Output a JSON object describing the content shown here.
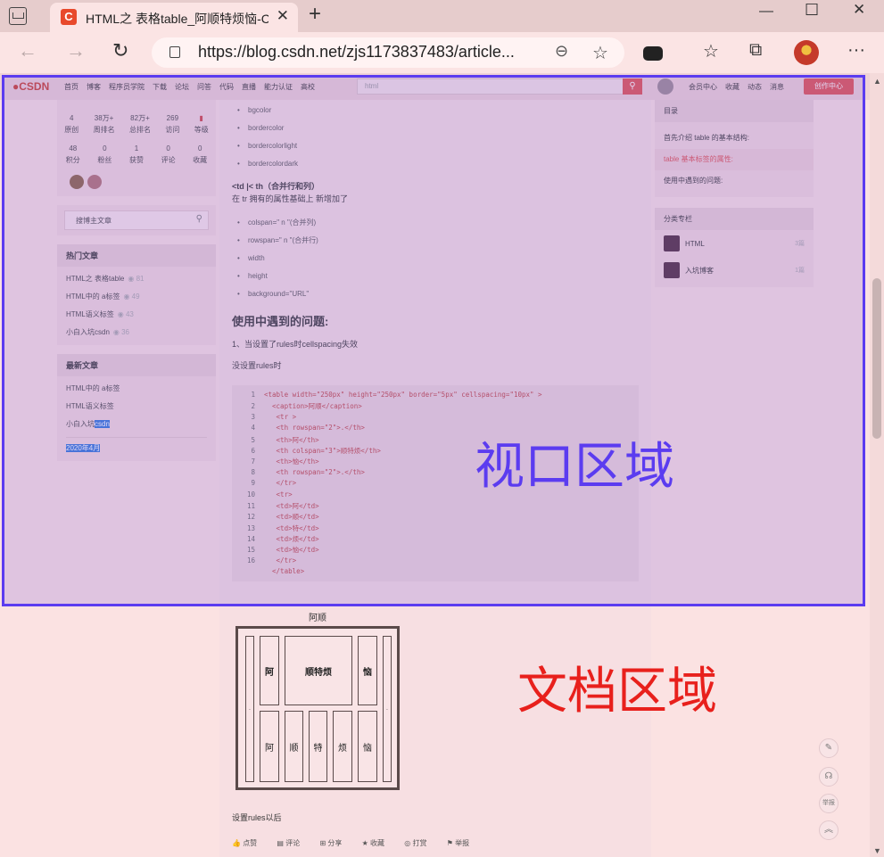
{
  "browser": {
    "tab_title": "HTML之 表格table_阿顺特烦恼-C",
    "tab_favicon": "C",
    "url": "https://blog.csdn.net/zjs1173837483/article...",
    "win_min": "—",
    "win_max": "☐",
    "win_close": "✕",
    "new_tab": "+",
    "back": "←",
    "forward": "→",
    "reload": "↻",
    "zoom": "⊖",
    "favorites": "☆",
    "collections": "⧉",
    "more": "···"
  },
  "csdn": {
    "logo": "●CSDN",
    "nav": [
      "首页",
      "博客",
      "程序员学院",
      "下载",
      "论坛",
      "问答",
      "代码",
      "直播",
      "能力认证",
      "高校"
    ],
    "search_placeholder": "html",
    "search_btn": "⚲",
    "right_links": [
      "会员中心",
      "收藏",
      "动态",
      "消息"
    ],
    "create_btn": "创作中心"
  },
  "sidebar": {
    "stats_row1": [
      {
        "value": "4",
        "label": "原创"
      },
      {
        "value": "38万+",
        "label": "周排名"
      },
      {
        "value": "82万+",
        "label": "总排名"
      },
      {
        "value": "269",
        "label": "访问"
      },
      {
        "value": "",
        "label": "等级"
      }
    ],
    "stats_row2": [
      {
        "value": "48",
        "label": "积分"
      },
      {
        "value": "0",
        "label": "粉丝"
      },
      {
        "value": "1",
        "label": "获赞"
      },
      {
        "value": "0",
        "label": "评论"
      },
      {
        "value": "0",
        "label": "收藏"
      }
    ],
    "search_placeholder": "搜博主文章",
    "hot_title": "热门文章",
    "hot": [
      {
        "title": "HTML之 表格table",
        "views": "81"
      },
      {
        "title": "HTML中的 a标签",
        "views": "49"
      },
      {
        "title": "HTML语义标签",
        "views": "43"
      },
      {
        "title": "小白入坑csdn",
        "views": "36"
      }
    ],
    "latest_title": "最新文章",
    "latest": [
      "HTML中的 a标签",
      "HTML语义标签"
    ],
    "latest_hl_prefix": "小白入坑",
    "latest_hl_suffix": "csdn",
    "archive_label": "2020年4月"
  },
  "article": {
    "attr_list1": [
      "bgcolor",
      "bordercolor",
      "bordercolorlight",
      "bordercolordark"
    ],
    "td_title": "<td |< th（合并行和列）",
    "td_desc": "在 tr 拥有的属性基础上 新增加了",
    "attr_list2": [
      "colspan=\" n \"(合并列)",
      "rowspan=\" n \"(合并行)",
      "width",
      "height",
      "background=\"URL\""
    ],
    "problems_heading": "使用中遇到的问题:",
    "problem1": "1、当设置了rules时cellspacing失效",
    "no_rules": "没设置rules时",
    "code": [
      {
        "n": "1",
        "t": "<table width=\"250px\" height=\"250px\" border=\"5px\" cellspacing=\"10px\" >"
      },
      {
        "n": "2",
        "t": "  <caption>阿顺</caption>"
      },
      {
        "n": "3",
        "t": "   <tr >"
      },
      {
        "n": "4",
        "t": "   <th rowspan=\"2\">.</th>"
      },
      {
        "n": "5",
        "t": "   <th>阿</th>"
      },
      {
        "n": "6",
        "t": "   <th colspan=\"3\">顺特烦</th>"
      },
      {
        "n": "7",
        "t": "   <th>恼</th>"
      },
      {
        "n": "8",
        "t": "   <th rowspan=\"2\">.</th>"
      },
      {
        "n": "9",
        "t": "   </tr>"
      },
      {
        "n": "10",
        "t": "   <tr>"
      },
      {
        "n": "11",
        "t": "   <td>阿</td>"
      },
      {
        "n": "12",
        "t": "   <td>顺</td>"
      },
      {
        "n": "13",
        "t": "   <td>特</td>"
      },
      {
        "n": "14",
        "t": "   <td>烦</td>"
      },
      {
        "n": "15",
        "t": "   <td>恼</td>"
      },
      {
        "n": "16",
        "t": "   </tr>"
      },
      {
        "n": "",
        "t": "  </table>"
      }
    ],
    "demo_caption": "阿顺",
    "demo_row1": [
      "阿",
      "顺特烦",
      "恼"
    ],
    "demo_row2": [
      "阿",
      "顺",
      "特",
      "烦",
      "恼"
    ],
    "dot": ".",
    "after_rules": "设置rules以后",
    "actions": [
      "点赞",
      "评论",
      "分享",
      "收藏",
      "打赏",
      "举报"
    ]
  },
  "toc": {
    "title": "目录",
    "items": [
      "首先介绍 table 的基本结构:",
      "table 基本标签的属性:",
      "使用中遇到的问题:"
    ]
  },
  "columns": {
    "title": "分类专栏",
    "items": [
      {
        "name": "HTML",
        "count": "3篇"
      },
      {
        "name": "入坑博客",
        "count": "1篇"
      }
    ]
  },
  "float_buttons": [
    "✎",
    "☊",
    "举报",
    "︽"
  ],
  "overlay": {
    "viewport_label": "视口区域",
    "document_label": "文档区域",
    "viewport_color": "#5b3cf0",
    "document_color": "#e8201c"
  }
}
